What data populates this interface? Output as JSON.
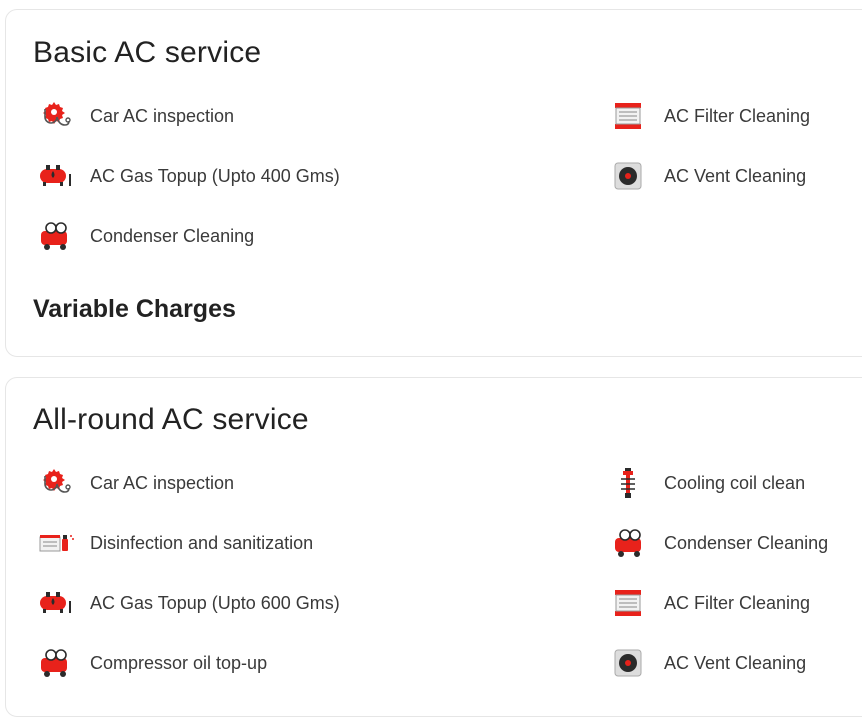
{
  "colors": {
    "accent": "#e8221b",
    "dark": "#2b2b2b",
    "border": "#e6e6e6"
  },
  "packages": [
    {
      "title": "Basic AC service",
      "left_features": [
        {
          "label": "Car AC inspection",
          "icon": "stethoscope-gear-icon"
        },
        {
          "label": "AC Gas Topup (Upto 400 Gms)",
          "icon": "gas-cylinder-icon"
        },
        {
          "label": "Condenser Cleaning",
          "icon": "compressor-icon"
        }
      ],
      "right_features": [
        {
          "label": "AC Filter Cleaning",
          "icon": "ac-filter-icon"
        },
        {
          "label": "AC Vent Cleaning",
          "icon": "ac-vent-icon"
        }
      ],
      "variable_charges_label": "Variable Charges"
    },
    {
      "title": "All-round AC service",
      "left_features": [
        {
          "label": "Car AC inspection",
          "icon": "stethoscope-gear-icon"
        },
        {
          "label": "Disinfection and sanitization",
          "icon": "sanitizer-spray-icon"
        },
        {
          "label": "AC Gas Topup (Upto 600 Gms)",
          "icon": "gas-cylinder-icon"
        },
        {
          "label": "Compressor oil top-up",
          "icon": "compressor-icon"
        }
      ],
      "right_features": [
        {
          "label": "Cooling coil clean",
          "icon": "cooling-coil-icon"
        },
        {
          "label": "Condenser Cleaning",
          "icon": "compressor-icon"
        },
        {
          "label": "AC Filter Cleaning",
          "icon": "ac-filter-icon"
        },
        {
          "label": "AC Vent Cleaning",
          "icon": "ac-vent-icon"
        }
      ]
    }
  ]
}
